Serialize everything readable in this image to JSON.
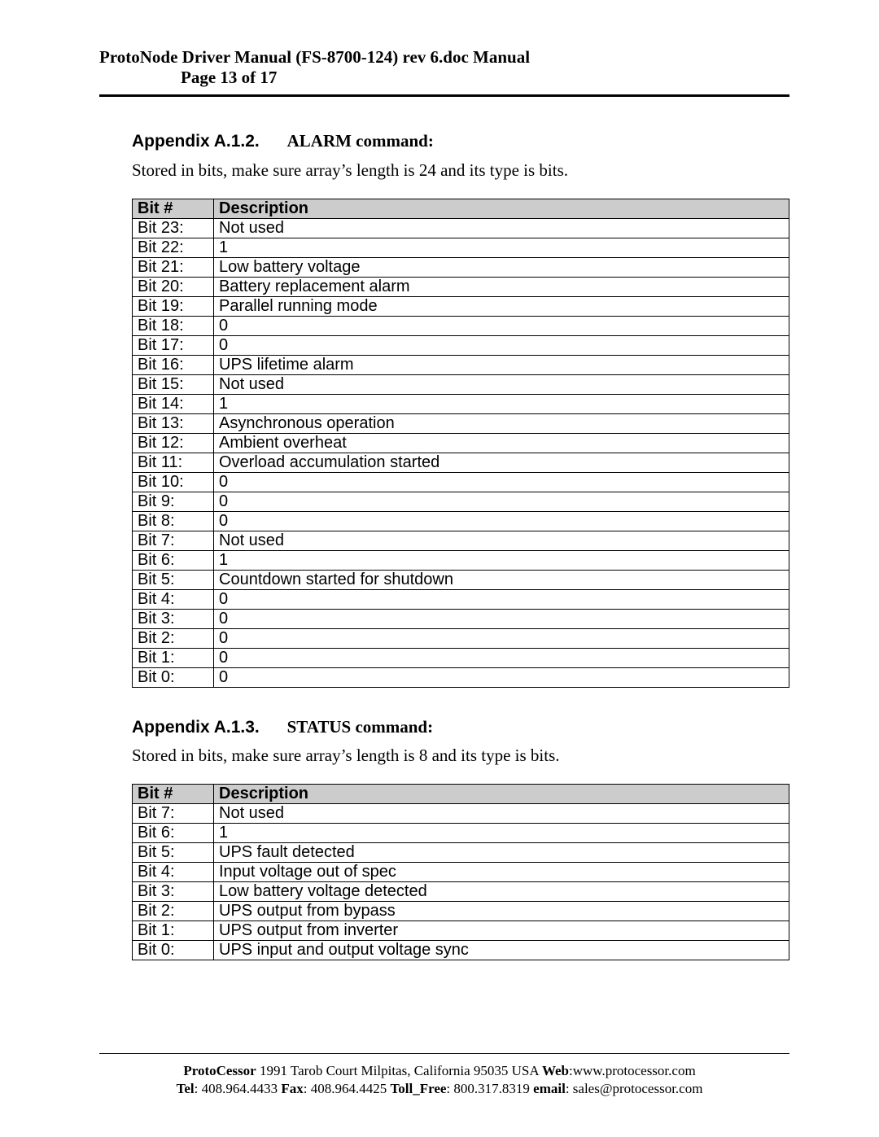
{
  "header": {
    "title_line1": "ProtoNode Driver Manual (FS-8700-124) rev 6.doc Manual",
    "title_line2": "Page 13 of 17"
  },
  "section1": {
    "num": "Appendix A.1.2.",
    "title": "ALARM command:",
    "intro": "Stored in bits, make sure array’s length is 24 and its type is bits.",
    "col1": "Bit #",
    "col2": "Description",
    "rows": [
      {
        "b": "Bit 23:",
        "d": "Not used"
      },
      {
        "b": "Bit 22:",
        "d": "1"
      },
      {
        "b": "Bit 21:",
        "d": "Low battery voltage"
      },
      {
        "b": "Bit 20:",
        "d": "Battery replacement alarm"
      },
      {
        "b": "Bit 19:",
        "d": "Parallel running mode"
      },
      {
        "b": "Bit 18:",
        "d": "0"
      },
      {
        "b": "Bit 17:",
        "d": "0"
      },
      {
        "b": "Bit 16:",
        "d": "UPS lifetime alarm"
      },
      {
        "b": "Bit 15:",
        "d": "Not used"
      },
      {
        "b": "Bit 14:",
        "d": "1"
      },
      {
        "b": "Bit 13:",
        "d": "Asynchronous operation"
      },
      {
        "b": "Bit 12:",
        "d": "Ambient overheat"
      },
      {
        "b": "Bit 11:",
        "d": "Overload accumulation started"
      },
      {
        "b": "Bit 10:",
        "d": "0"
      },
      {
        "b": "Bit 9:",
        "d": "0"
      },
      {
        "b": "Bit 8:",
        "d": "0"
      },
      {
        "b": "Bit 7:",
        "d": "Not used"
      },
      {
        "b": "Bit 6:",
        "d": "1"
      },
      {
        "b": "Bit 5:",
        "d": "Countdown started for shutdown"
      },
      {
        "b": "Bit 4:",
        "d": "0"
      },
      {
        "b": "Bit 3:",
        "d": "0"
      },
      {
        "b": "Bit 2:",
        "d": "0"
      },
      {
        "b": "Bit 1:",
        "d": "0"
      },
      {
        "b": "Bit 0:",
        "d": "0"
      }
    ]
  },
  "section2": {
    "num": "Appendix A.1.3.",
    "title": "STATUS command:",
    "intro": "Stored in bits, make sure array’s length is 8 and its type is bits.",
    "col1": "Bit #",
    "col2": "Description",
    "rows": [
      {
        "b": "Bit 7:",
        "d": "Not used"
      },
      {
        "b": "Bit 6:",
        "d": "1"
      },
      {
        "b": "Bit 5:",
        "d": "UPS fault detected"
      },
      {
        "b": "Bit 4:",
        "d": "Input voltage out of spec"
      },
      {
        "b": "Bit 3:",
        "d": "Low battery voltage detected"
      },
      {
        "b": "Bit 2:",
        "d": "UPS output from bypass"
      },
      {
        "b": "Bit 1:",
        "d": "UPS output from inverter"
      },
      {
        "b": "Bit 0:",
        "d": "UPS input and output voltage sync"
      }
    ]
  },
  "footer": {
    "company": "ProtoCessor",
    "addr": " 1991 Tarob Court Milpitas, California 95035 USA ",
    "web_lbl": "Web",
    "web": ":www.protocessor.com",
    "tel_lbl": "Tel",
    "tel": ": 408.964.4433  ",
    "fax_lbl": "Fax",
    "fax": ": 408.964.4425  ",
    "tf_lbl": "Toll_Free",
    "tf": ": 800.317.8319  ",
    "email_lbl": "email",
    "email": ": sales@protocessor.com"
  }
}
